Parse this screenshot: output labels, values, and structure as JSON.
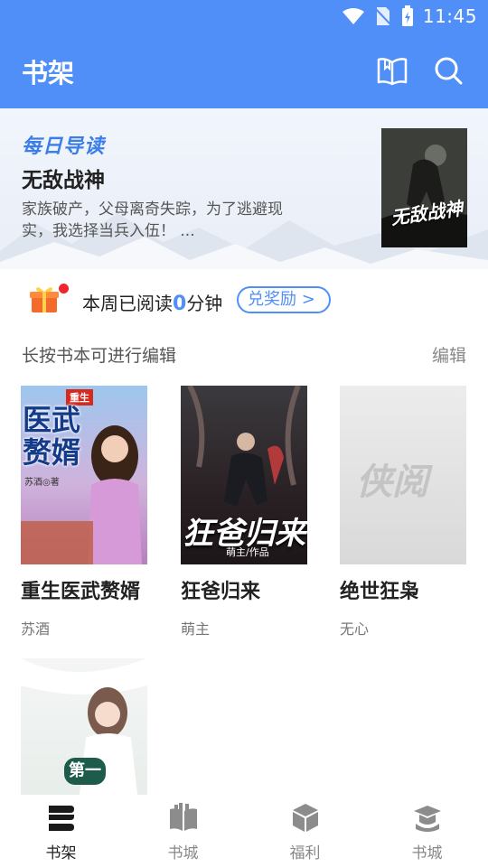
{
  "status_bar": {
    "time": "11:45"
  },
  "app_bar": {
    "title": "书架",
    "book_icon": "open-book-icon",
    "search_icon": "search-icon"
  },
  "daily_read": {
    "tag": "每日导读",
    "title": "无敌战神",
    "description": "家族破产，父母离奇失踪，为了逃避现实，我选择当兵入伍！ ...",
    "cover_title": "无敌战神"
  },
  "reward": {
    "prefix": "本周已阅读",
    "minutes": "0",
    "suffix": "分钟",
    "button_label": "兑奖励 >"
  },
  "shelf_header": {
    "hint": "长按书本可进行编辑",
    "edit_label": "编辑"
  },
  "books": [
    {
      "title": "重生医武赘婿",
      "author": "苏酒",
      "cover_main": "医武赘婿",
      "cover_tag": "重生",
      "cover_author": "苏酒◎著"
    },
    {
      "title": "狂爸归来",
      "author": "萌主",
      "cover_main": "狂爸归来",
      "cover_author": "萌主/作品"
    },
    {
      "title": "绝世狂枭",
      "author": "无心",
      "cover_main": "侠阅"
    },
    {
      "title": "",
      "author": "",
      "cover_tag": "第一"
    }
  ],
  "bottom_nav": [
    {
      "label": "书架",
      "icon": "bookshelf-icon",
      "active": true
    },
    {
      "label": "书城",
      "icon": "book-stack-icon",
      "active": false
    },
    {
      "label": "福利",
      "icon": "gift-box-icon",
      "active": false
    },
    {
      "label": "书城",
      "icon": "mortarboard-icon",
      "active": false
    }
  ],
  "colors": {
    "primary": "#4f8ff7",
    "badge": "#f0262e"
  }
}
